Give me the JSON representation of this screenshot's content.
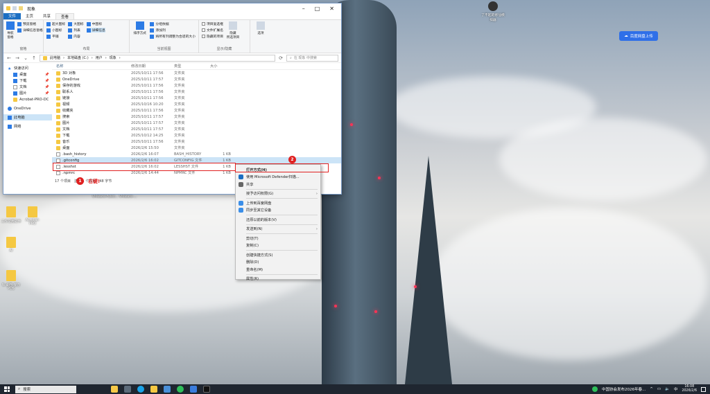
{
  "explorer": {
    "title": "现象",
    "tabs": [
      "文件",
      "主页",
      "共享",
      "查看"
    ],
    "ribbon": {
      "panes": {
        "nav_pane": "导航窗格",
        "preview": "预览窗格",
        "details": "详细信息窗格",
        "label": "窗格"
      },
      "layout": {
        "items": [
          "超大图标",
          "大图标",
          "中图标",
          "小图标",
          "列表",
          "详细信息",
          "平铺",
          "内容"
        ],
        "label": "布局"
      },
      "current_view": {
        "sort": "排序方式",
        "group": "分组依据",
        "add_col": "添加列",
        "fit": "将所有列调整为合适的大小",
        "label": "当前视图"
      },
      "show_hide": {
        "items": [
          "项目复选框",
          "文件扩展名",
          "隐藏的项目"
        ],
        "hide": "隐藏",
        "hide2": "所选项目",
        "label": "显示/隐藏"
      },
      "options": "选项"
    },
    "address": {
      "crumbs": [
        "此电脑",
        "本地磁盘 (C:)",
        "用户",
        "现象"
      ],
      "search_placeholder": "在 现象 中搜索"
    },
    "nav": [
      {
        "label": "快速访问",
        "sub": false
      },
      {
        "label": "桌面",
        "sub": true,
        "pin": "📌"
      },
      {
        "label": "下载",
        "sub": true,
        "pin": "📌"
      },
      {
        "label": "文档",
        "sub": true,
        "pin": "📌"
      },
      {
        "label": "图片",
        "sub": true,
        "pin": "📌"
      },
      {
        "label": "Acrobat-PRO-DC",
        "sub": true
      },
      {
        "label": "OneDrive",
        "sub": false
      },
      {
        "label": "此电脑",
        "sub": false
      },
      {
        "label": "网络",
        "sub": false
      }
    ],
    "columns": [
      "名称",
      "修改日期",
      "类型",
      "大小"
    ],
    "files": [
      {
        "name": "3D 对象",
        "date": "2025/10/11 17:56",
        "type": "文件夹",
        "size": ""
      },
      {
        "name": "OneDrive",
        "date": "2025/10/11 17:57",
        "type": "文件夹",
        "size": ""
      },
      {
        "name": "保存的游戏",
        "date": "2025/10/11 17:56",
        "type": "文件夹",
        "size": ""
      },
      {
        "name": "联系人",
        "date": "2025/10/11 17:56",
        "type": "文件夹",
        "size": ""
      },
      {
        "name": "链接",
        "date": "2025/10/11 17:56",
        "type": "文件夹",
        "size": ""
      },
      {
        "name": "视频",
        "date": "2025/10/16 10:20",
        "type": "文件夹",
        "size": ""
      },
      {
        "name": "收藏夹",
        "date": "2025/10/11 17:56",
        "type": "文件夹",
        "size": ""
      },
      {
        "name": "搜索",
        "date": "2025/10/11 17:57",
        "type": "文件夹",
        "size": ""
      },
      {
        "name": "图片",
        "date": "2025/10/11 17:57",
        "type": "文件夹",
        "size": ""
      },
      {
        "name": "文档",
        "date": "2025/10/11 17:57",
        "type": "文件夹",
        "size": ""
      },
      {
        "name": "下载",
        "date": "2025/10/12 14:25",
        "type": "文件夹",
        "size": ""
      },
      {
        "name": "音乐",
        "date": "2025/10/11 17:56",
        "type": "文件夹",
        "size": ""
      },
      {
        "name": "桌面",
        "date": "2026/2/6 15:50",
        "type": "文件夹",
        "size": ""
      },
      {
        "name": ".bash_history",
        "date": "2026/2/6 16:07",
        "type": "BASH_HISTORY",
        "size": "1 KB"
      },
      {
        "name": ".gitconfig",
        "date": "2026/2/6 16:02",
        "type": "GITCONFIG 文件",
        "size": "1 KB"
      },
      {
        "name": ".lesshst",
        "date": "2026/2/6 16:02",
        "type": "LESSHST 文件",
        "size": "1 KB"
      },
      {
        "name": ".npmrc",
        "date": "2026/2/6 14:44",
        "type": "NPMRC 文件",
        "size": "1 KB"
      }
    ],
    "status": {
      "count": "17 个项目",
      "selected": "选中 1 个项目",
      "size": "48 字节"
    }
  },
  "context_menu": [
    {
      "label": "打开方式(H)",
      "bold": true
    },
    {
      "label": "使用 Microsoft Defender扫描...",
      "icon": "shield-icon"
    },
    {
      "label": "共享",
      "icon": "share-icon"
    },
    {
      "sep": true
    },
    {
      "label": "授予访问权限(G)",
      "arrow": true
    },
    {
      "sep": true
    },
    {
      "label": "上传到百度网盘",
      "icon": "cloud-icon"
    },
    {
      "label": "同步至其它设备",
      "icon": "cloud-icon"
    },
    {
      "sep": true
    },
    {
      "label": "还原以前的版本(V)"
    },
    {
      "sep": true
    },
    {
      "label": "发送到(N)",
      "arrow": true
    },
    {
      "sep": true
    },
    {
      "label": "剪切(T)"
    },
    {
      "label": "复制(C)"
    },
    {
      "sep": true
    },
    {
      "label": "创建快捷方式(S)"
    },
    {
      "label": "删除(D)"
    },
    {
      "label": "重命名(M)"
    },
    {
      "sep": true
    },
    {
      "label": "属性(R)"
    }
  ],
  "annotations": {
    "step1": "1",
    "step1_text": "右键!",
    "step2": "2"
  },
  "desktop": {
    "icons": [
      {
        "label": "工作常用软件"
      },
      {
        "label": "Acrobat-PRO"
      },
      {
        "label": "AI"
      },
      {
        "label": "N-桌面 保存PDS"
      }
    ],
    "top_icon": "了不起的修仙模拟器",
    "cloud_button": "百度网盘上传",
    "behind_label": "VMware-Fusio... VMware-..."
  },
  "taskbar": {
    "search": "搜索",
    "news": "中国协会发布2026年春...",
    "ime": "中",
    "time": "16:08",
    "date": "2026/2/6"
  }
}
